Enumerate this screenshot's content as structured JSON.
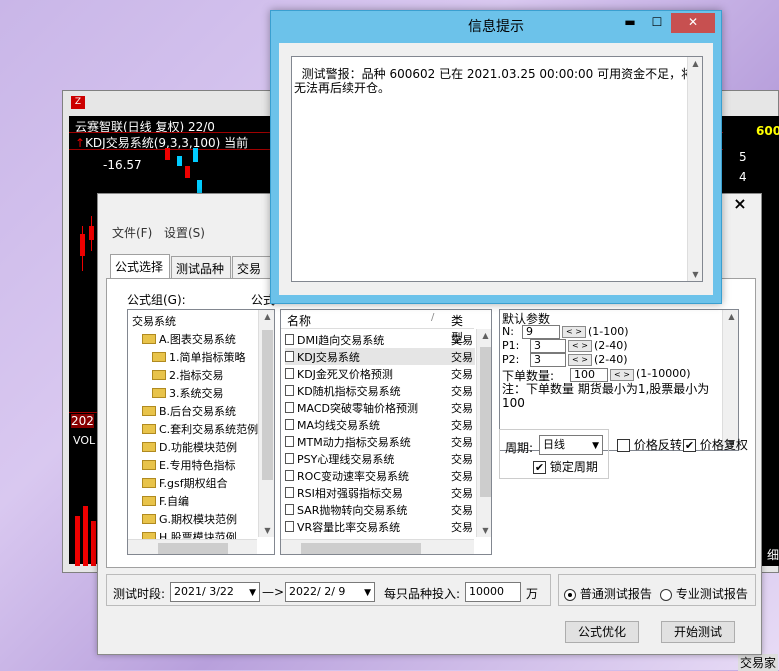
{
  "chart_window": {
    "title": "云赛智联(日线 复权) 22/0",
    "subtitle": "KDJ交易系统(9,3,3,100) 当前",
    "price_label": "-16.57",
    "side_price": "600",
    "side_nums": [
      "5",
      "4"
    ],
    "vol_label": "VOL",
    "date_label": "202",
    "right_label": "细",
    "corner_label": "交易家"
  },
  "main_dialog": {
    "close_label": "×",
    "menus": [
      "文件(F)",
      "设置(S)"
    ],
    "tabs": [
      "公式选择",
      "测试品种",
      "交易费"
    ],
    "formula_group_label": "公式组(G):",
    "formula_label_cut": "公式",
    "tree": [
      "交易系统",
      "A.图表交易系统",
      "1.简单指标策略",
      "2.指标交易",
      "3.系统交易",
      "B.后台交易系统",
      "C.套利交易系统范例",
      "D.功能模块范例",
      "E.专用特色指标",
      "F.gsf期权组合",
      "F.自编",
      "G.期权模块范例",
      "H.股票模块范例"
    ],
    "list_header": {
      "name": "名称",
      "type": "类型"
    },
    "list": [
      "DMI趋向交易系统",
      "KDJ交易系统",
      "KDJ金死叉价格预测",
      "KD随机指标交易系统",
      "MACD突破零轴价格预测",
      "MA均线交易系统",
      "MTM动力指标交易系统",
      "PSY心理线交易系统",
      "ROC变动速率交易系统",
      "RSI相对强弱指标交易",
      "SAR抛物转向交易系统",
      "VR容量比率交易系统"
    ],
    "list_type_value": "交易",
    "params": {
      "title": "默认参数",
      "n_label": "N:",
      "n_value": "9",
      "n_range": "(1-100)",
      "p1_label": "P1:",
      "p1_value": "3",
      "p1_range": "(2-40)",
      "p2_label": "P2:",
      "p2_value": "3",
      "p2_range": "(2-40)",
      "qty_label": "下单数量:",
      "qty_value": "100",
      "qty_range": "(1-10000)",
      "note": "注：下单数量 期货最小为1,股票最小为100"
    },
    "period_label": "周期:",
    "period_value": "日线",
    "price_reverse": "价格反转",
    "price_adjust": "价格复权",
    "lock_period": "锁定周期",
    "test_period_label": "测试时段:",
    "start_date": "2021/ 3/22",
    "end_date": "2022/ 2/ 9",
    "arrow_between": "—>",
    "invest_label": "每只品种投入:",
    "invest_value": "10000",
    "invest_unit": "万",
    "report_normal": "普通测试报告",
    "report_pro": "专业测试报告",
    "btn_optimize": "公式优化",
    "btn_start": "开始测试"
  },
  "message_box": {
    "title": "信息提示",
    "text": "  测试警报：品种 600602 已在 2021.03.25 00:00:00 可用资金不足，将无法再后续开仓。"
  }
}
